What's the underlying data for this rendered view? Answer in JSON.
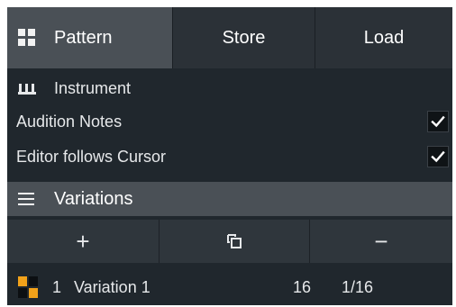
{
  "tabs": {
    "pattern": "Pattern",
    "store": "Store",
    "load": "Load"
  },
  "instrument": {
    "label": "Instrument"
  },
  "options": {
    "audition_notes": {
      "label": "Audition Notes",
      "checked": true
    },
    "editor_follows_cursor": {
      "label": "Editor follows Cursor",
      "checked": true
    }
  },
  "variations": {
    "header": "Variations",
    "actions": {
      "add": "+",
      "remove": "−"
    },
    "items": [
      {
        "index": "1",
        "name": "Variation 1",
        "steps": "16",
        "resolution": "1/16"
      }
    ]
  },
  "colors": {
    "panel_bg": "#20272d",
    "header_bg": "#4a5056",
    "accent_orange": "#f2a21a"
  },
  "icons": {
    "pattern_tab": "grid-icon",
    "instrument": "piano-keys-icon",
    "variations": "menu-icon",
    "add": "plus-icon",
    "duplicate": "duplicate-icon",
    "remove": "minus-icon",
    "variation": "pattern-variation-icon",
    "check": "checkmark-icon"
  }
}
